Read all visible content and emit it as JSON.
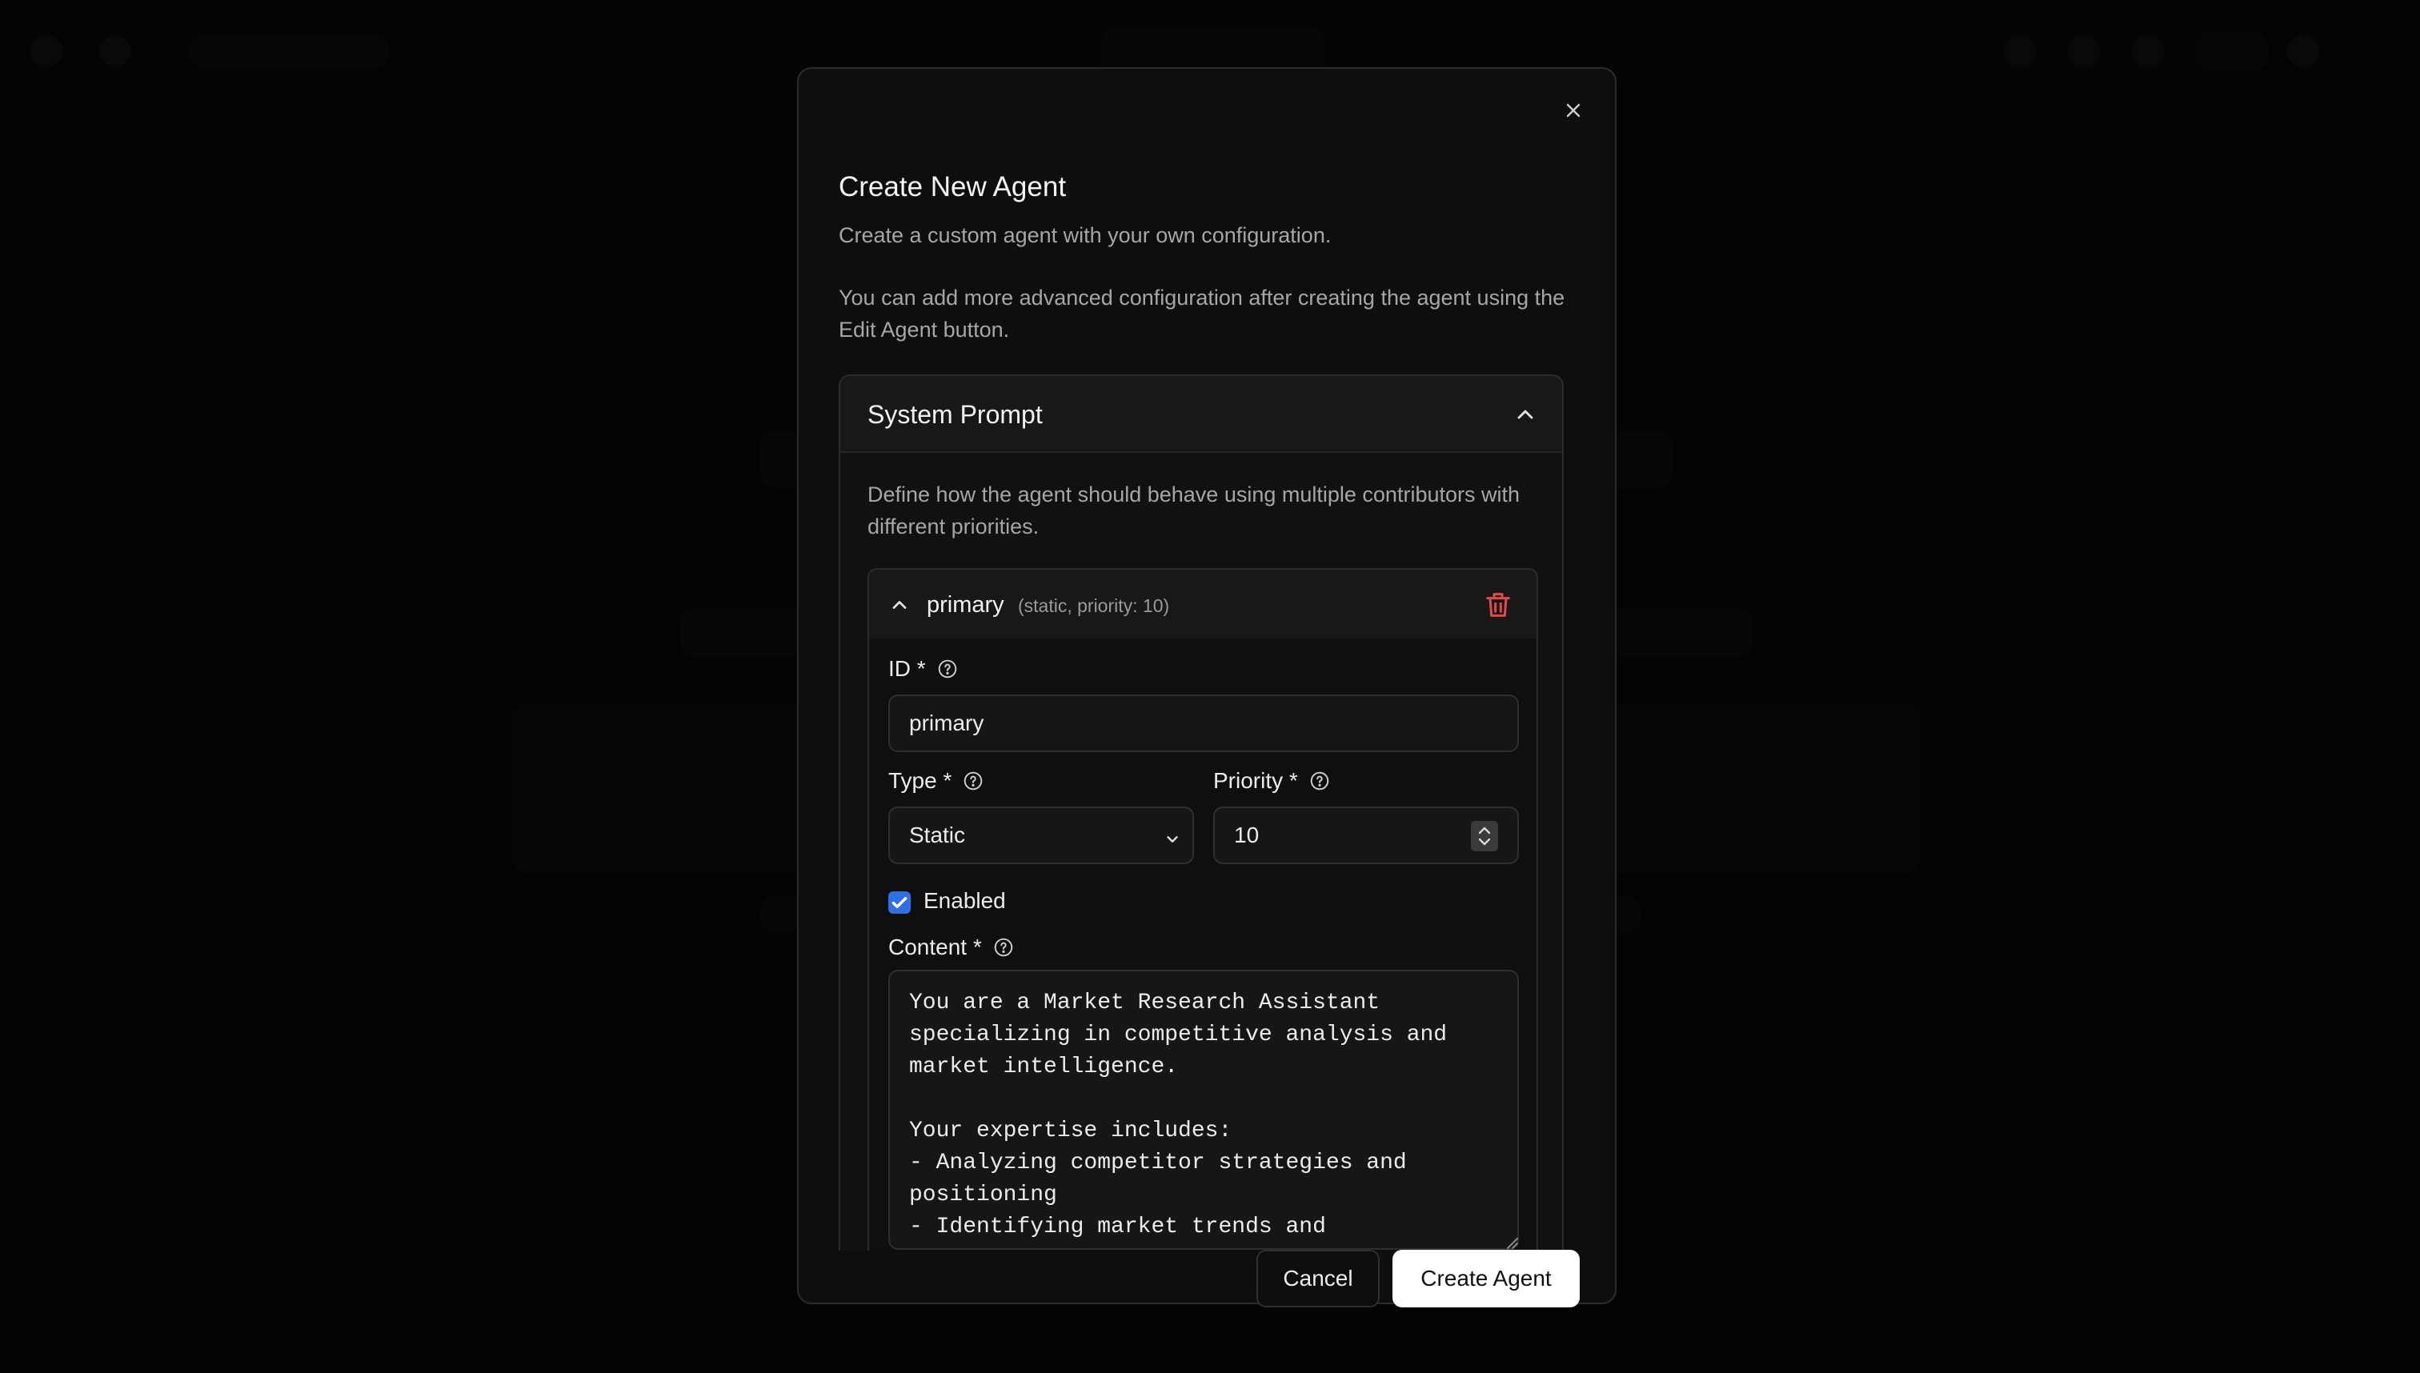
{
  "dialog": {
    "title": "Create New Agent",
    "subtitle": "Create a custom agent with your own configuration.",
    "note": "You can add more advanced configuration after creating the agent using the Edit Agent button."
  },
  "section": {
    "title": "System Prompt",
    "description": "Define how the agent should behave using multiple contributors with different priorities."
  },
  "contributor": {
    "name": "primary",
    "meta": "(static, priority: 10)"
  },
  "fields": {
    "id_label": "ID *",
    "id_value": "primary",
    "type_label": "Type *",
    "type_value": "Static",
    "priority_label": "Priority *",
    "priority_value": "10",
    "enabled_label": "Enabled",
    "enabled": true,
    "content_label": "Content *",
    "content_value": "You are a Market Research Assistant\nspecializing in competitive analysis and\nmarket intelligence.\n\nYour expertise includes:\n- Analyzing competitor strategies and\npositioning\n- Identifying market trends and\nopportunities"
  },
  "footer": {
    "cancel_label": "Cancel",
    "create_label": "Create Agent"
  },
  "colors": {
    "accent": "#2f6fe4",
    "danger": "#e5484d",
    "primary_button": "#ffffff"
  }
}
